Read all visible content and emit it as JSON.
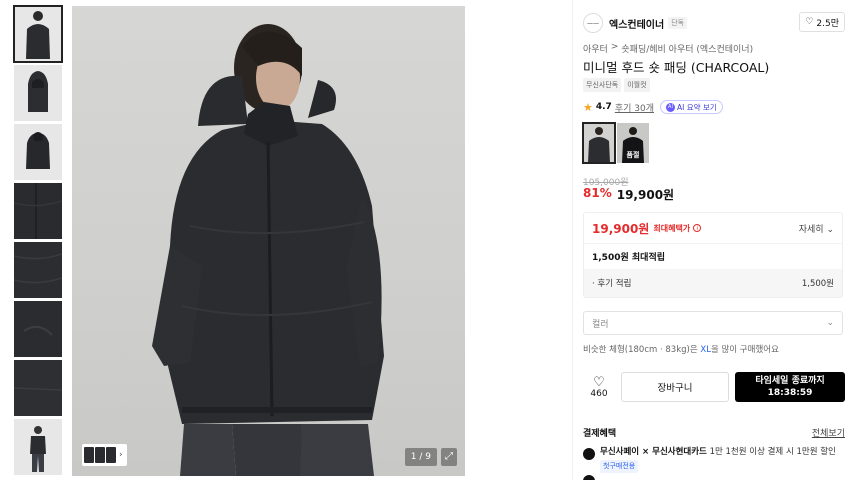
{
  "gallery": {
    "thumbnails": [
      "thumb-1",
      "thumb-2",
      "thumb-3",
      "thumb-4",
      "thumb-5",
      "thumb-6",
      "thumb-7",
      "thumb-8"
    ],
    "counter": "1 / 9",
    "expand_icon": "expand-icon"
  },
  "brand": {
    "name": "엑스컨테이너",
    "logo_text": "——",
    "tag": "단독",
    "likes": "2.5만"
  },
  "product": {
    "breadcrumb": [
      "아우터",
      ">",
      "숏패딩/헤비 아우터 (엑스컨테이너)"
    ],
    "title": "미니멀 후드 숏 패딩 (CHARCOAL)",
    "badges": [
      "무신사단독",
      "이월컷"
    ],
    "rating": "4.7",
    "reviews": "후기 30개",
    "ai_label": "AI 요약 보기",
    "ai_icon_text": "AI",
    "colors": [
      {
        "name": "charcoal",
        "selected": true
      },
      {
        "name": "black",
        "soldout_label": "품절"
      }
    ],
    "original_price": "105,000원",
    "discount": "81%",
    "price": "19,900원"
  },
  "benefit": {
    "price": "19,900원",
    "label": "최대혜택가",
    "info_icon": "i",
    "detail": "자세히",
    "points_label": "1,500원 최대적립",
    "review_label": "· 후기 적립",
    "review_amount": "1,500원"
  },
  "options": {
    "color_placeholder": "컬러",
    "size_hint_prefix": "비슷한 체형(180cm · 83kg)은 ",
    "size_hint_size": "XL",
    "size_hint_suffix": "을 많이 구매했어요"
  },
  "actions": {
    "wish_count": "460",
    "cart": "장바구니",
    "buy_line1": "타임세일 종료까지",
    "buy_line2": "18:38:59"
  },
  "payment": {
    "header": "결제혜택",
    "more": "전체보기",
    "row1_bold": "무신사페이 × 무신사현대카드",
    "row1_rest": " 1만 1천원 이상 결제 시 1만원 할인",
    "row1_tag": "첫구매전용"
  }
}
